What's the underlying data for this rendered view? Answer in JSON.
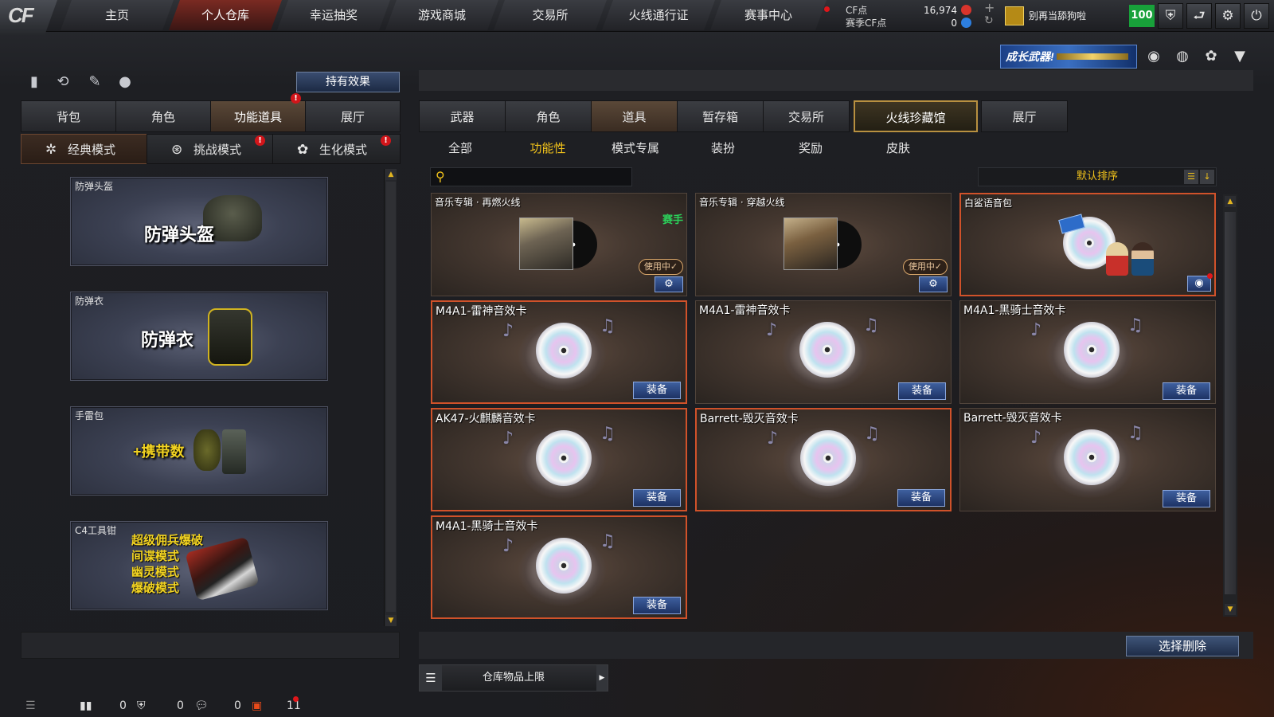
{
  "nav": {
    "logo": "CF",
    "tabs": [
      "主页",
      "个人仓库",
      "幸运抽奖",
      "游戏商城",
      "交易所",
      "火线通行证",
      "赛事中心"
    ],
    "active_tab": "个人仓库"
  },
  "currency": {
    "cf_label": "CF点",
    "cf_value": "16,974",
    "season_label": "赛季CF点",
    "season_value": "0"
  },
  "player": {
    "name": "别再当舔狗啦",
    "level": "100"
  },
  "promo": {
    "text": "成长武器!"
  },
  "left": {
    "effect_button": "持有效果",
    "tabs": [
      "背包",
      "角色",
      "功能道具",
      "展厅"
    ],
    "active_tab": "功能道具",
    "modes": [
      "经典模式",
      "挑战模式",
      "生化模式"
    ],
    "active_mode": "经典模式",
    "cards": [
      {
        "title": "防弹头盔",
        "big": "防弹头盔"
      },
      {
        "title": "防弹衣",
        "big": "防弹衣"
      },
      {
        "title": "手雷包",
        "big": "+携带数"
      },
      {
        "title": "C4工具钳",
        "lines": [
          "超级佣兵爆破",
          "间谍模式",
          "幽灵模式",
          "爆破模式"
        ]
      }
    ]
  },
  "right": {
    "tabs": [
      "武器",
      "角色",
      "道具",
      "暂存箱",
      "交易所",
      "火线珍藏馆",
      "展厅"
    ],
    "active_tab": "道具",
    "selected_tab": "火线珍藏馆",
    "subtabs": [
      "全部",
      "功能性",
      "模式专属",
      "装扮",
      "奖励",
      "皮肤"
    ],
    "active_subtab": "功能性",
    "search_placeholder": "",
    "sort_label": "默认排序",
    "items": [
      {
        "name": "音乐专辑 · 再燃火线",
        "tag": "赛手",
        "in_use": "使用中✓"
      },
      {
        "name": "音乐专辑 · 穿越火线",
        "in_use": "使用中✓"
      },
      {
        "name": "白鲨语音包"
      },
      {
        "name": "M4A1-雷神音效卡",
        "action": "装备"
      },
      {
        "name": "M4A1-雷神音效卡",
        "action": "装备"
      },
      {
        "name": "M4A1-黑骑士音效卡",
        "action": "装备"
      },
      {
        "name": "AK47-火麒麟音效卡",
        "action": "装备"
      },
      {
        "name": "Barrett-毁灭音效卡",
        "action": "装备"
      },
      {
        "name": "Barrett-毁灭音效卡",
        "action": "装备"
      },
      {
        "name": "M4A1-黑骑士音效卡",
        "action": "装备"
      }
    ],
    "delete_button": "选择删除",
    "limit_label": "仓库物品上限"
  },
  "status": {
    "c1": "0",
    "c2": "0",
    "c3": "0",
    "c4": "11"
  }
}
